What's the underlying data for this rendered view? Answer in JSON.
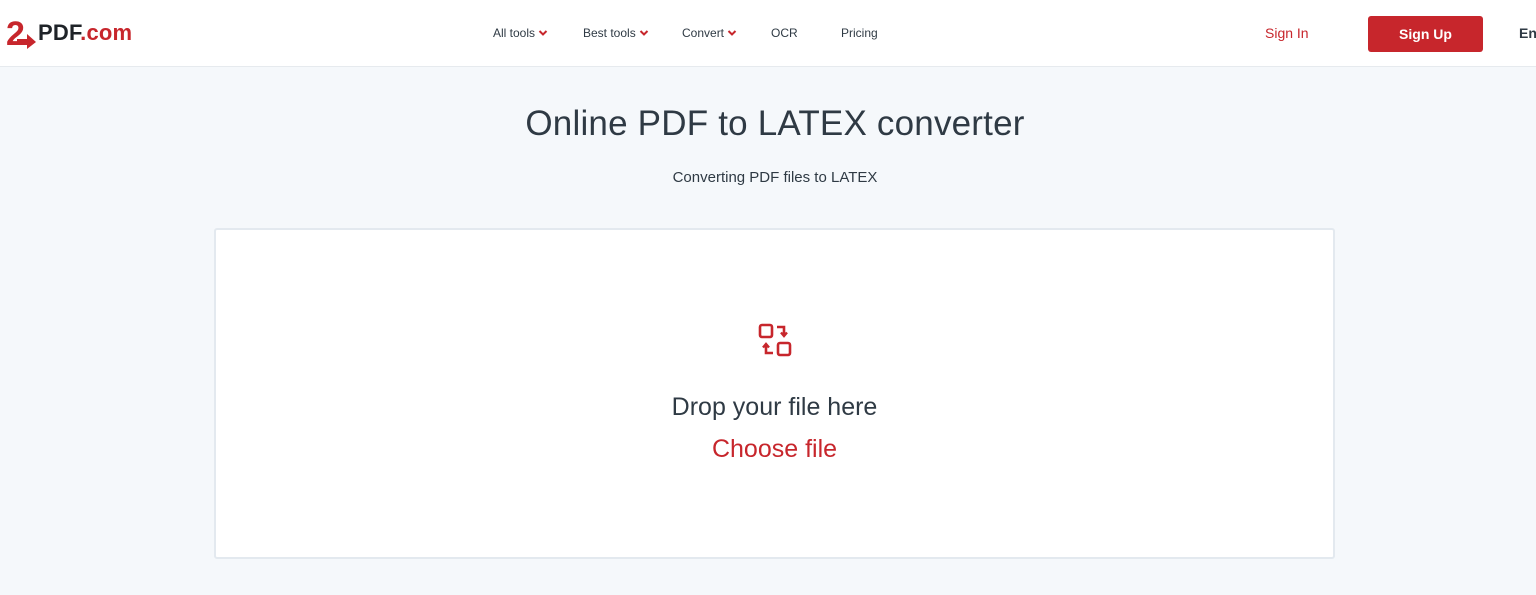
{
  "logo": {
    "mark": "2",
    "name": "PDF",
    "suffix": ".com"
  },
  "nav": {
    "items": [
      {
        "label": "All tools",
        "has_dropdown": true
      },
      {
        "label": "Best tools",
        "has_dropdown": true
      },
      {
        "label": "Convert",
        "has_dropdown": true
      },
      {
        "label": "OCR",
        "has_dropdown": false
      },
      {
        "label": "Pricing",
        "has_dropdown": false
      }
    ]
  },
  "auth": {
    "sign_in": "Sign In",
    "sign_up": "Sign Up"
  },
  "language": "En",
  "main": {
    "title": "Online PDF to LATEX converter",
    "subtitle": "Converting PDF files to LATEX"
  },
  "dropzone": {
    "icon": "convert-icon",
    "drop_text": "Drop your file here",
    "choose_label": "Choose file"
  },
  "colors": {
    "accent": "#c7262c",
    "text": "#2f3a44",
    "background": "#f5f8fb",
    "panel": "#ffffff"
  }
}
